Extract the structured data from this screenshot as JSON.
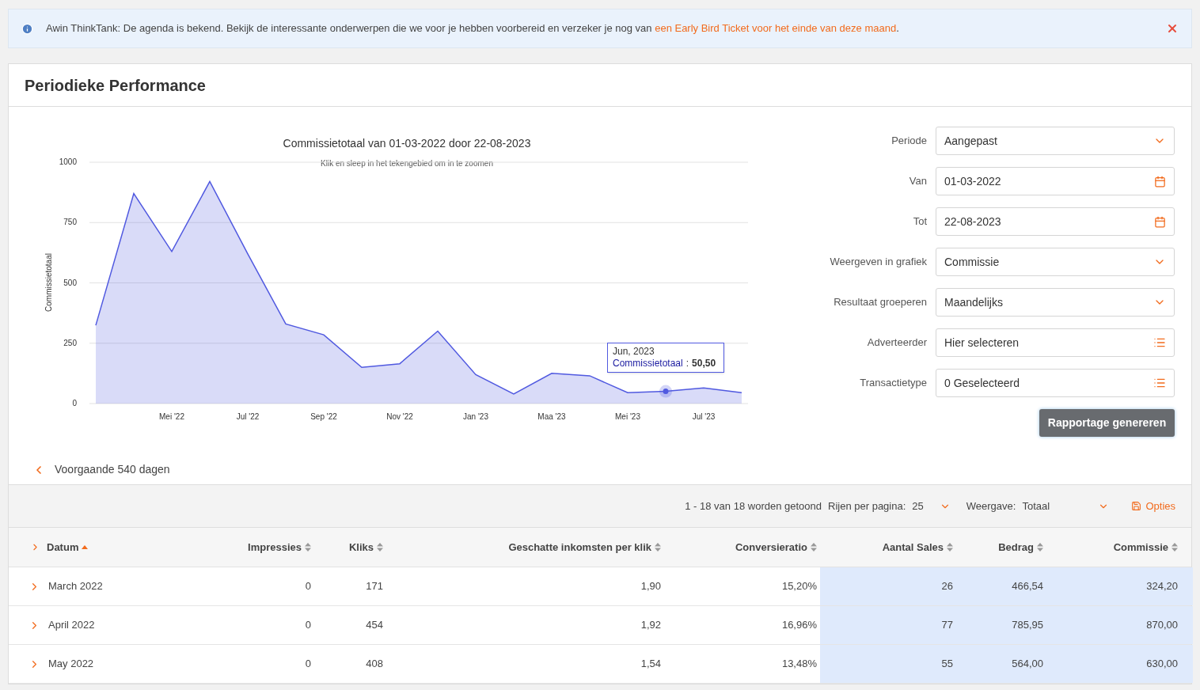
{
  "banner": {
    "text": "Awin ThinkTank: De agenda is bekend. Bekijk de interessante onderwerpen die we voor je hebben voorbereid en verzeker je nog van ",
    "link": "een Early Bird Ticket voor het einde van deze maand",
    "after": "."
  },
  "card": {
    "title": "Periodieke Performance"
  },
  "chart": {
    "subtitle": "Klik en sleep in het tekengebied om in te zoomen",
    "chart_data": {
      "type": "area",
      "title": "Commissietotaal van 01-03-2022 door 22-08-2023",
      "ylabel": "Commissietotaal",
      "categories": [
        null,
        null,
        "Mei '22",
        null,
        "Jul '22",
        null,
        "Sep '22",
        null,
        "Nov '22",
        null,
        "Jan '23",
        null,
        "Maa '23",
        null,
        "Mei '23",
        null,
        "Jul '23",
        null
      ],
      "series": [
        {
          "name": "Commissietotaal",
          "color": "#5059e0",
          "values": [
            324.2,
            870,
            630,
            920,
            620,
            330,
            285,
            150,
            165,
            300,
            120,
            40,
            125,
            115,
            45,
            50.5,
            65,
            45
          ]
        }
      ],
      "ylim": [
        0,
        1000
      ],
      "yticks": [
        0,
        250,
        500,
        750,
        1000
      ],
      "grid": true
    },
    "tooltip": {
      "date": "Jun, 2023",
      "separator": ":",
      "value": "50,50"
    }
  },
  "form": {
    "fields": [
      {
        "label": "Periode",
        "value": "Aangepast",
        "kind": "select"
      },
      {
        "label": "Van",
        "value": "01-03-2022",
        "kind": "date"
      },
      {
        "label": "Tot",
        "value": "22-08-2023",
        "kind": "date"
      },
      {
        "label": "Weergeven in grafiek",
        "value": "Commissie",
        "kind": "select"
      },
      {
        "label": "Resultaat groeperen",
        "value": "Maandelijks",
        "kind": "select"
      },
      {
        "label": "Adverteerder",
        "value": "Hier selecteren",
        "kind": "list"
      },
      {
        "label": "Transactietype",
        "value": "0 Geselecteerd",
        "kind": "list"
      }
    ],
    "button": "Rapportage genereren"
  },
  "previous": "Voorgaande 540 dagen",
  "toolbar": {
    "count": "1 - 18 van 18 worden getoond",
    "rows_label": "Rijen per pagina:",
    "rows_value": "25",
    "view_label": "Weergave:",
    "view_value": "Totaal",
    "options": "Opties"
  },
  "table": {
    "columns": [
      {
        "label": "Datum",
        "sorted": true,
        "highlighted": false
      },
      {
        "label": "Impressies",
        "sorted": false,
        "highlighted": false
      },
      {
        "label": "Kliks",
        "sorted": false,
        "highlighted": false
      },
      {
        "label": "Geschatte inkomsten per klik",
        "sorted": false,
        "highlighted": false
      },
      {
        "label": "Conversieratio",
        "sorted": false,
        "highlighted": false
      },
      {
        "label": "Aantal Sales",
        "sorted": false,
        "highlighted": true
      },
      {
        "label": "Bedrag",
        "sorted": false,
        "highlighted": true
      },
      {
        "label": "Commissie",
        "sorted": false,
        "highlighted": true
      }
    ],
    "rows": [
      {
        "expanded": false,
        "cells": [
          "March 2022",
          "0",
          "171",
          "1,90",
          "15,20%",
          "26",
          "466,54",
          "324,20"
        ]
      },
      {
        "expanded": false,
        "cells": [
          "April 2022",
          "0",
          "454",
          "1,92",
          "16,96%",
          "77",
          "785,95",
          "870,00"
        ]
      },
      {
        "expanded": false,
        "cells": [
          "May 2022",
          "0",
          "408",
          "1,54",
          "13,48%",
          "55",
          "564,00",
          "630,00"
        ]
      }
    ]
  }
}
